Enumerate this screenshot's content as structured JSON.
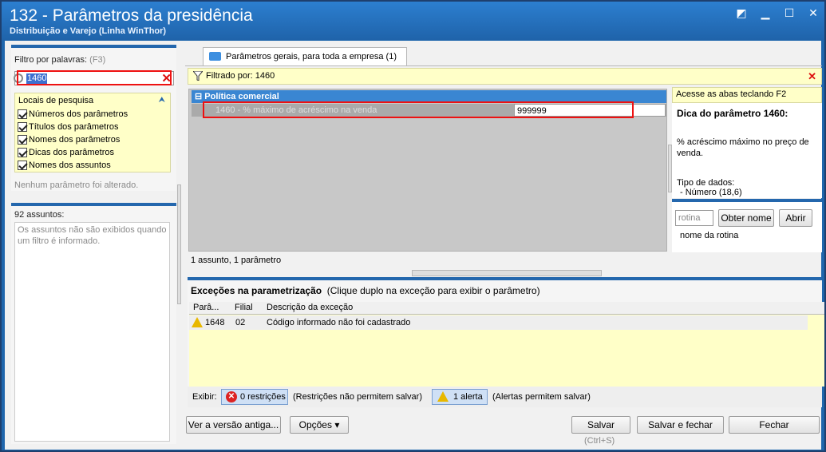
{
  "window": {
    "title": "132 - Parâmetros da presidência",
    "subtitle": "Distribuição e Varejo (Linha WinThor)",
    "controls": [
      "restore",
      "minimize",
      "maximize",
      "close"
    ]
  },
  "left": {
    "filter_label": "Filtro por palavras:",
    "filter_shortcut": "(F3)",
    "search_value": "1460",
    "search_places_title": "Locais de pesquisa",
    "search_places": [
      {
        "label": "Números dos parâmetros",
        "checked": true
      },
      {
        "label": "Títulos dos parâmetros",
        "checked": true
      },
      {
        "label": "Nomes dos parâmetros",
        "checked": true
      },
      {
        "label": "Dicas dos parâmetros",
        "checked": true
      },
      {
        "label": "Nomes dos assuntos",
        "checked": true
      }
    ],
    "no_change_msg": "Nenhum parâmetro foi alterado.",
    "subjects_count": "92 assuntos:",
    "subjects_msg": "Os assuntos não são exibidos quando um filtro é informado."
  },
  "main": {
    "tab_label": "Parâmetros gerais, para toda a empresa  (1)",
    "filtered_by": "Filtrado por: 1460",
    "group": "Política comercial",
    "param_label": "1460 - % máximo de acréscimo na venda",
    "param_value": "999999",
    "status": "1 assunto, 1 parâmetro"
  },
  "tip": {
    "hint": "Acesse as abas teclando F2",
    "title": "Dica do parâmetro 1460:",
    "description": "% acréscimo máximo no preço de venda.",
    "type_label": "Tipo de dados:",
    "type_value": "- Número (18,6)",
    "routine_placeholder": "rotina",
    "get_name_button": "Obter nome",
    "open_button": "Abrir",
    "routine_name": "nome da rotina"
  },
  "exceptions": {
    "title": "Exceções na parametrização",
    "hint": "(Clique duplo na exceção para exibir o parâmetro)",
    "columns": [
      "Parâ...",
      "Filial",
      "Descrição da exceção"
    ],
    "rows": [
      {
        "param": "1648",
        "filial": "02",
        "desc": "Código informado não foi cadastrado"
      }
    ],
    "show_label": "Exibir:",
    "restrictions_badge": "0 restrições",
    "restrictions_note": "(Restrições não permitem salvar)",
    "alerts_badge": "1 alerta",
    "alerts_note": "(Alertas permitem salvar)"
  },
  "footer": {
    "old_version_button": "Ver a versão antiga...",
    "options_button": "Opções",
    "save_button": "Salvar",
    "save_shortcut": "(Ctrl+S)",
    "save_close_button": "Salvar e fechar",
    "close_button": "Fechar"
  },
  "colors": {
    "title_blue": "#1f66ac",
    "accent": "#2467ad",
    "yellow_panel": "#ffffc8",
    "highlight_red": "#e11111"
  }
}
